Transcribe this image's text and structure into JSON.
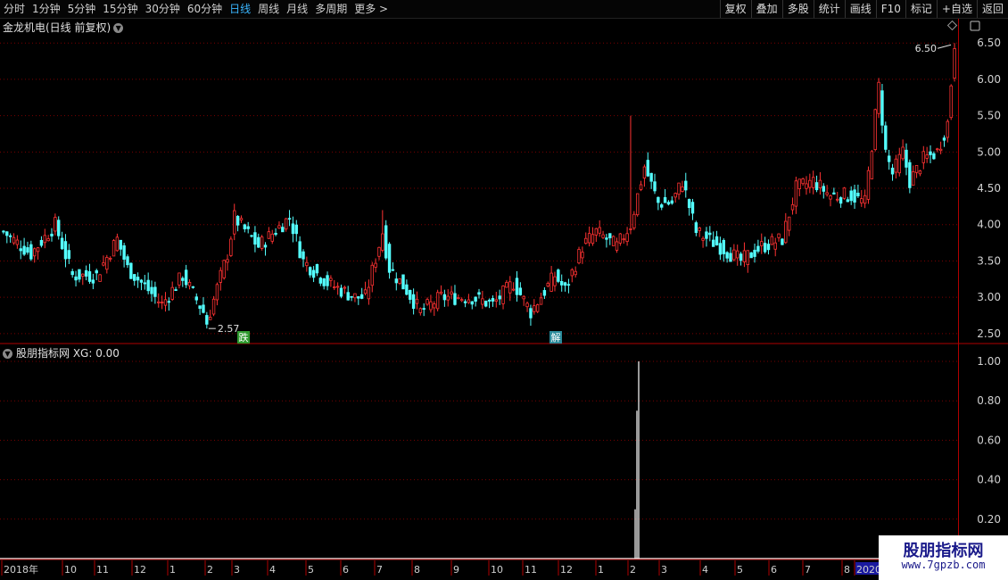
{
  "toolbar": {
    "periods": [
      "分时",
      "1分钟",
      "5分钟",
      "15分钟",
      "30分钟",
      "60分钟",
      "日线",
      "周线",
      "月线",
      "多周期",
      "更多 >"
    ],
    "active": "日线",
    "buttons": [
      "复权",
      "叠加",
      "多股",
      "统计",
      "画线",
      "F10",
      "标记",
      "+自选",
      "返回"
    ]
  },
  "main_chart": {
    "title": "金龙机电(日线 前复权)",
    "y_ticks": [
      "6.50",
      "6.00",
      "5.50",
      "5.00",
      "4.50",
      "4.00",
      "3.50",
      "3.00",
      "2.50"
    ],
    "high_label": "6.50",
    "low_label": "2.57",
    "markers": [
      {
        "text": "跌",
        "color": "#2e9a2e"
      },
      {
        "text": "解",
        "color": "#2a8a9a"
      }
    ]
  },
  "indicator": {
    "title": "股朋指标网 XG: 0.00",
    "y_ticks": [
      "1.00",
      "0.80",
      "0.60",
      "0.40",
      "0.20"
    ]
  },
  "x_axis": {
    "labels": [
      "2018年",
      "10",
      "11",
      "12",
      "1",
      "2",
      "3",
      "4",
      "5",
      "6",
      "7",
      "8",
      "9",
      "10",
      "11",
      "12",
      "1",
      "2",
      "3",
      "4",
      "5",
      "6",
      "7",
      "8",
      "2020"
    ]
  },
  "watermark": {
    "line1": "股朋指标网",
    "line2": "www.7gpzb.com"
  },
  "colors": {
    "up": "#ff3232",
    "down": "#54ffff",
    "grid": "#7a0000",
    "axis": "#b00000",
    "active_tab": "#3ab6ff"
  },
  "chart_data": {
    "type": "candlestick",
    "title": "金龙机电(日线 前复权)",
    "ylim": [
      2.4,
      6.65
    ],
    "y_ticks": [
      2.5,
      3.0,
      3.5,
      4.0,
      4.5,
      5.0,
      5.5,
      6.0,
      6.5
    ],
    "keypoints": [
      [
        0,
        3.9
      ],
      [
        8,
        3.6
      ],
      [
        15,
        4.0
      ],
      [
        20,
        3.3
      ],
      [
        27,
        3.3
      ],
      [
        33,
        3.8
      ],
      [
        36,
        3.4
      ],
      [
        46,
        2.9
      ],
      [
        52,
        3.3
      ],
      [
        58,
        2.8
      ],
      [
        59,
        2.65
      ],
      [
        65,
        3.6
      ],
      [
        67,
        4.1
      ],
      [
        74,
        3.7
      ],
      [
        83,
        4.1
      ],
      [
        87,
        3.5
      ],
      [
        94,
        3.2
      ],
      [
        102,
        3.0
      ],
      [
        105,
        3.0
      ],
      [
        110,
        3.9
      ],
      [
        112,
        3.4
      ],
      [
        117,
        3.1
      ],
      [
        121,
        2.8
      ],
      [
        127,
        3.0
      ],
      [
        136,
        3.0
      ],
      [
        142,
        2.9
      ],
      [
        148,
        3.2
      ],
      [
        153,
        2.8
      ],
      [
        160,
        3.3
      ],
      [
        163,
        3.1
      ],
      [
        168,
        3.7
      ],
      [
        172,
        3.9
      ],
      [
        178,
        3.7
      ],
      [
        182,
        4.0
      ],
      [
        186,
        4.8
      ],
      [
        190,
        4.3
      ],
      [
        194,
        4.3
      ],
      [
        197,
        4.6
      ],
      [
        201,
        3.9
      ],
      [
        208,
        3.7
      ],
      [
        214,
        3.5
      ],
      [
        220,
        3.7
      ],
      [
        226,
        3.8
      ],
      [
        230,
        4.5
      ],
      [
        235,
        4.6
      ],
      [
        240,
        4.4
      ],
      [
        246,
        4.4
      ],
      [
        250,
        4.3
      ],
      [
        252,
        5.1
      ],
      [
        254,
        5.9
      ],
      [
        256,
        5.0
      ],
      [
        258,
        4.7
      ],
      [
        261,
        5.0
      ],
      [
        263,
        4.6
      ],
      [
        267,
        4.9
      ],
      [
        271,
        5.0
      ],
      [
        274,
        5.4
      ],
      [
        276,
        6.5
      ]
    ],
    "labels": {
      "high": 6.5,
      "low": 2.57
    },
    "indicator": {
      "name": "XG",
      "value": 0.0,
      "spike_values": [
        1.0,
        0.75,
        0.25
      ],
      "ylim": [
        0,
        1.05
      ]
    }
  }
}
